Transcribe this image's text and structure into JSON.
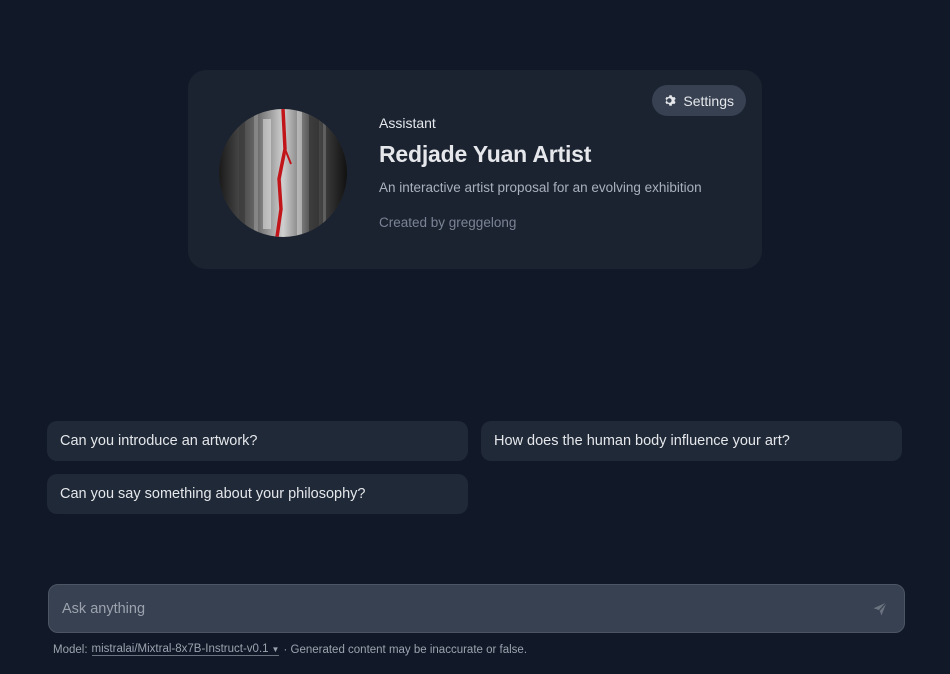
{
  "assistant_card": {
    "kind": "Assistant",
    "title": "Redjade Yuan Artist",
    "description": "An interactive artist proposal for an evolving exhibition",
    "author": "Created by greggelong",
    "settings_label": "Settings",
    "avatar_icon": "artwork-avatar"
  },
  "suggestions": [
    "Can you introduce an artwork?",
    "How does the human body influence your art?",
    "Can you say something about your philosophy?"
  ],
  "input": {
    "placeholder": "Ask anything",
    "send_icon": "send-icon"
  },
  "footer": {
    "model_prefix": "Model:",
    "model_name": "mistralai/Mixtral-8x7B-Instruct-v0.1",
    "disclaimer": "· Generated content may be inaccurate or false."
  },
  "colors": {
    "background": "#111827",
    "card": "#1b2331",
    "chip": "#1f2937",
    "input": "#374151"
  }
}
